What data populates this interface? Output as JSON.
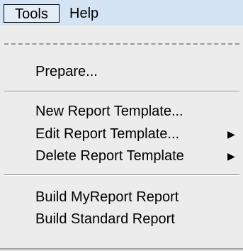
{
  "menubar": {
    "tools_label": "Tools",
    "help_label": "Help"
  },
  "tools_menu": {
    "items": [
      {
        "label": "Prepare..."
      },
      {
        "label": "New Report Template..."
      },
      {
        "label": "Edit Report Template...",
        "submenu_icon": "triangle-right"
      },
      {
        "label": "Delete Report Template",
        "submenu_icon": "triangle-right"
      },
      {
        "label": "Build MyReport Report"
      },
      {
        "label": "Build Standard Report"
      }
    ]
  }
}
